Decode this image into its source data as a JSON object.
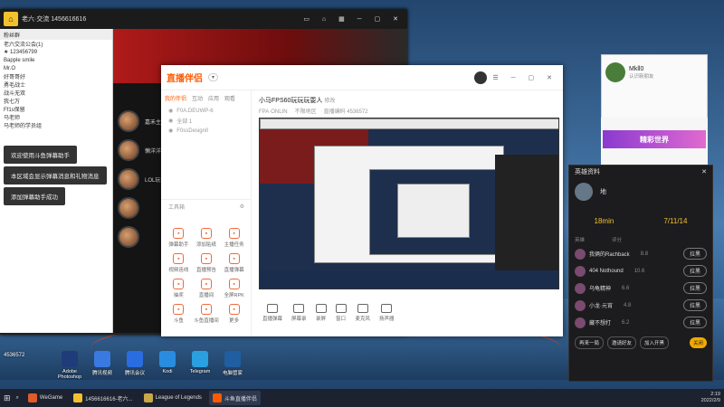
{
  "chat_window": {
    "title": "老六·交流 1456616616",
    "list_header": "粉丝群",
    "tree": [
      "老六交流公会(1)",
      "★ 123456799",
      "Bapple smile",
      "Mr.O",
      "好哥哥好",
      "勇毛战士",
      "战斗无双",
      "我七万",
      "Ff1s保留",
      "马老师",
      "马老师的学员组"
    ],
    "messages": [
      "欢迎使用斗鱼弹幕助手",
      "本区域会显示弹幕消息和礼物消息",
      "添加弹幕助手成功"
    ],
    "usernames": [
      "嘉禾主播",
      "懒洋洋",
      "LOL玩家"
    ]
  },
  "stream_app": {
    "logo": "直播伴侣",
    "tabs": [
      "我的伴侣",
      "互动",
      "应用",
      "观看"
    ],
    "side_rows": [
      "F0A.DEUWP-6",
      "全部 1",
      "F0ssDesign0"
    ],
    "tools_label": "工具箱",
    "grid": [
      {
        "label": "弹幕助手",
        "icon": "danmu-icon"
      },
      {
        "label": "添加贴纸",
        "icon": "sticker-icon"
      },
      {
        "label": "主播任务",
        "icon": "task-icon"
      },
      {
        "label": "视频连线",
        "icon": "link-icon"
      },
      {
        "label": "直播预告",
        "icon": "preview-icon"
      },
      {
        "label": "直播弹幕",
        "icon": "barrage-icon"
      },
      {
        "label": "抽奖",
        "icon": "lottery-icon"
      },
      {
        "label": "直播间",
        "icon": "room-icon"
      },
      {
        "label": "全屏RPK",
        "icon": "pk-icon"
      },
      {
        "label": "斗鱼",
        "icon": "douyu-icon"
      },
      {
        "label": "斗鱼直播间",
        "icon": "live-icon"
      },
      {
        "label": "更多",
        "icon": "more-icon"
      }
    ],
    "room_title": "小马FPS60玩玩玩耍人",
    "room_edit": "修改",
    "room_meta": [
      "FPA·ONLIN",
      "不限地区",
      "直播编码 4536572"
    ],
    "bottom": [
      "直播弹幕",
      "屏幕录",
      "录屏",
      "窗口",
      "麦克风",
      "扬声器"
    ]
  },
  "right_panel": {
    "user": "Mkll0",
    "subtitle": "认识新朋友",
    "banner": "精彩世界",
    "card_title": "英雄资料",
    "name": "地",
    "stats": [
      "18min",
      "7/11/14"
    ],
    "table_head": [
      "英雄",
      "评分"
    ],
    "rows": [
      {
        "name": "我俩的Rachback",
        "score": "8.8",
        "btn": "拉黑"
      },
      {
        "name": "404 Nothound",
        "score": "10.6",
        "btn": "拉黑"
      },
      {
        "name": "乌龟精神",
        "score": "6.6",
        "btn": "拉黑"
      },
      {
        "name": "小龙·元宵",
        "score": "4.8",
        "btn": "拉黑"
      },
      {
        "name": "藏不想打",
        "score": "6.2",
        "btn": "拉黑"
      }
    ],
    "footer": [
      "再来一局",
      "邀请好友",
      "加入开黑",
      "关闭"
    ]
  },
  "desktop_icons": [
    {
      "label": "Adobe Photoshop",
      "color": "#1f3b7a"
    },
    {
      "label": "腾讯视频",
      "color": "#3a7ae0"
    },
    {
      "label": "腾讯会议",
      "color": "#2a6de0"
    },
    {
      "label": "Kodi",
      "color": "#2a8ce0"
    },
    {
      "label": "Telegram",
      "color": "#2aa0e0"
    },
    {
      "label": "电脑管家",
      "color": "#1f5ea0"
    }
  ],
  "taskbar": {
    "items": [
      {
        "label": "WeGame",
        "color": "#e05a2a"
      },
      {
        "label": "1456616616-老六...",
        "color": "#f2c12e"
      },
      {
        "label": "League of Legends",
        "color": "#c8a84a"
      },
      {
        "label": "斗鱼直播伴侣",
        "color": "#ff5a00"
      }
    ],
    "time": "2:19",
    "date": "2022/2/9"
  },
  "stream_id": "4536572"
}
